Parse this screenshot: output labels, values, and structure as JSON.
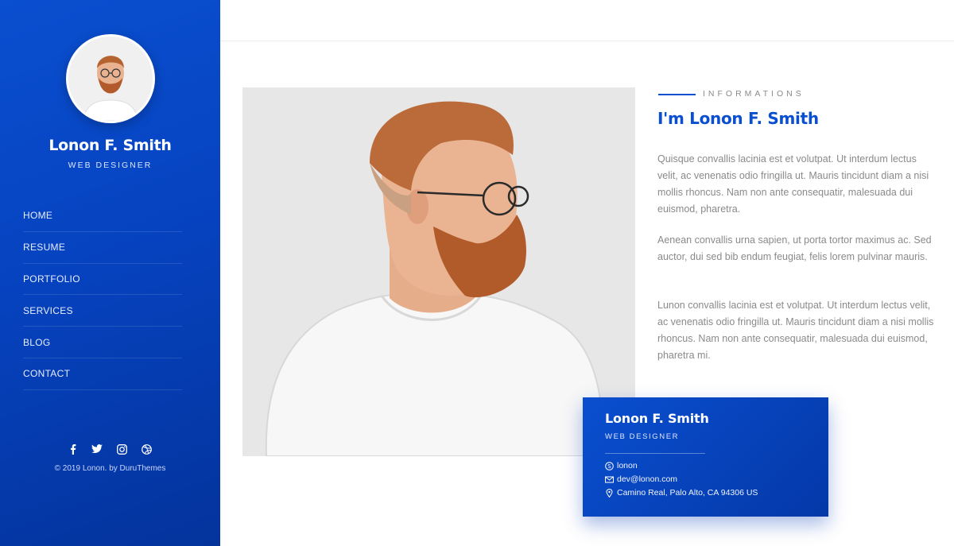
{
  "sidebar": {
    "name": "Lonon F. Smith",
    "role": "WEB DESIGNER",
    "nav": [
      "HOME",
      "RESUME",
      "PORTFOLIO",
      "SERVICES",
      "BLOG",
      "CONTACT"
    ],
    "social": [
      "facebook-icon",
      "twitter-icon",
      "instagram-icon",
      "dribbble-icon"
    ],
    "copyright": "© 2019 Lonon. by DuruThemes"
  },
  "main": {
    "label": "INFORMATIONS",
    "title": "I'm Lonon F. Smith",
    "paragraphs": [
      "Quisque convallis lacinia est et volutpat. Ut interdum lectus velit, ac venenatis odio fringilla ut. Mauris tincidunt diam a nisi mollis rhoncus. Nam non ante consequatir, malesuada dui euismod, pharetra.",
      "Aenean convallis urna sapien, ut porta tortor maximus ac. Sed auctor, dui sed bib endum feugiat, felis lorem pulvinar mauris.",
      "Lunon convallis lacinia est et volutpat. Ut interdum lectus velit, ac venenatis odio fringilla ut. Mauris tincidunt diam a nisi mollis rhoncus. Nam non ante consequatir, malesuada dui euismod, pharetra mi."
    ]
  },
  "card": {
    "name": "Lonon F. Smith",
    "role": "WEB DESIGNER",
    "skype": "lonon",
    "email": "dev@lonon.com",
    "address": "Camino Real, Palo Alto, CA 94306 US"
  },
  "colors": {
    "accent": "#0a4fd0",
    "text_muted": "#8a8a8a"
  }
}
